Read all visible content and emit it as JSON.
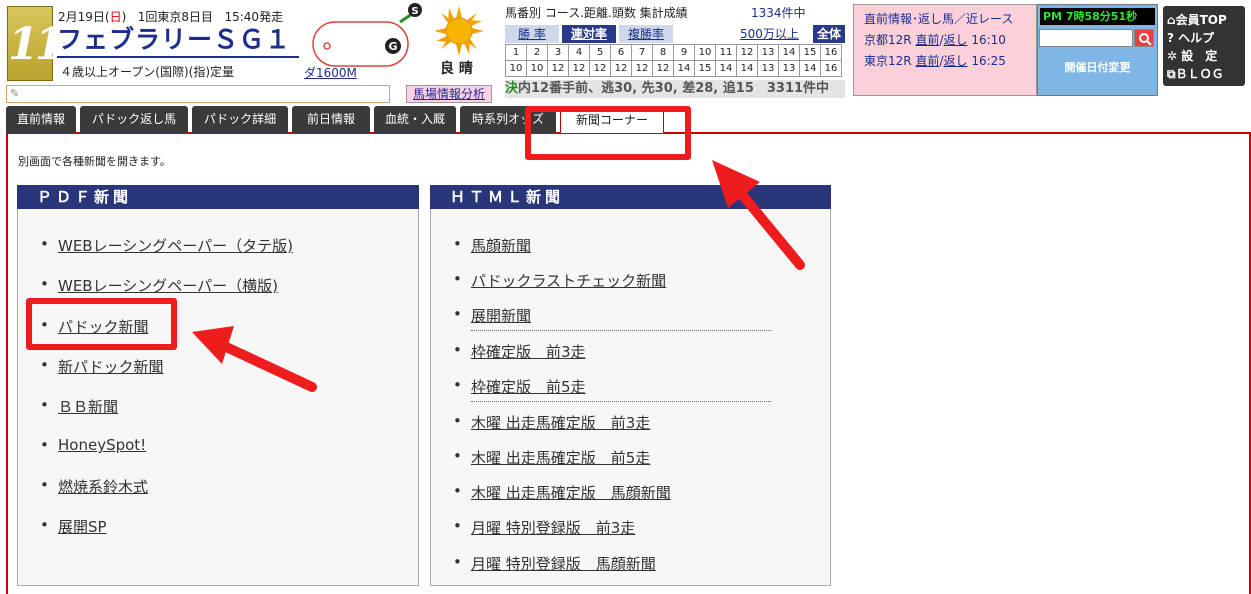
{
  "race": {
    "number": "11",
    "date": "2月19日(",
    "dow": "日",
    "date_close": ")",
    "meeting": "1回東京8日目",
    "post_time": "15:40発走",
    "name": "フェブラリーＳＧ１",
    "condition": "４歳以上オープン(国際)(指)定量",
    "distance": "ダ1600M",
    "course_marker_start": "S",
    "course_marker_goal": "G",
    "weather": "良 晴"
  },
  "stats": {
    "title": "馬番別 コース.距離.頭数 集計成績",
    "count": "1334件中",
    "tabs": [
      "勝 率",
      "連対率",
      "複勝率"
    ],
    "active_tab": "連対率",
    "over": "500万以上",
    "all": "全体",
    "row1": [
      "1",
      "2",
      "3",
      "4",
      "5",
      "6",
      "7",
      "8",
      "9",
      "10",
      "11",
      "12",
      "13",
      "14",
      "15",
      "16"
    ],
    "row2": [
      "10",
      "10",
      "12",
      "12",
      "12",
      "12",
      "12",
      "12",
      "14",
      "15",
      "14",
      "14",
      "13",
      "13",
      "14",
      "16"
    ]
  },
  "ticker": {
    "g": "決",
    "text": "内12番手前、逃30, 先30, 差28, 追15　3311件中"
  },
  "info": {
    "title": "直前情報･返し馬／近レース",
    "line1_a": "京都12R ",
    "line1_b": "直前",
    "line1_c": "/",
    "line1_d": "返し",
    "line1_e": " 16:10",
    "line2_a": "東京12R ",
    "line2_b": "直前",
    "line2_c": "/",
    "line2_d": "返し",
    "line2_e": " 16:25"
  },
  "clock": {
    "time": "PM 7時58分51秒",
    "date_change": "開催日付変更"
  },
  "side_menu": [
    "⌂会員TOP",
    "? ヘルプ",
    "✲ 設　定",
    "⧉ＢＬＯＧ"
  ],
  "memo_icon": "✎",
  "ground_btn": "馬場情報分析",
  "tabs": [
    "直前情報",
    "パドック返し馬",
    "パドック詳細",
    "前日情報",
    "血統・入厩",
    "時系列オッズ",
    "新聞コーナー"
  ],
  "active_tab": "新聞コーナー",
  "intro": "別画面で各種新聞を開きます。",
  "pdf": {
    "title": "ＰＤＦ新聞",
    "items": [
      "WEBレーシングペーパー（タテ版)",
      "WEBレーシングペーパー（横版)",
      "パドック新聞",
      "新パドック新聞",
      "ＢＢ新聞",
      "HoneySpot!",
      "燃焼系鈴木式",
      "展開SP"
    ]
  },
  "html": {
    "title": "ＨＴＭＬ新聞",
    "items": [
      "馬顔新聞",
      "パドックラストチェック新聞",
      "展開新聞",
      "枠確定版　前3走",
      "枠確定版　前5走",
      "木曜 出走馬確定版　前3走",
      "木曜 出走馬確定版　前5走",
      "木曜 出走馬確定版　馬顔新聞",
      "月曜 特別登録版　前3走",
      "月曜 特別登録版　馬顔新聞"
    ]
  },
  "colors": {
    "highlight": "#ee1c1c",
    "navy": "#2a367a",
    "accent_red": "#c00"
  }
}
